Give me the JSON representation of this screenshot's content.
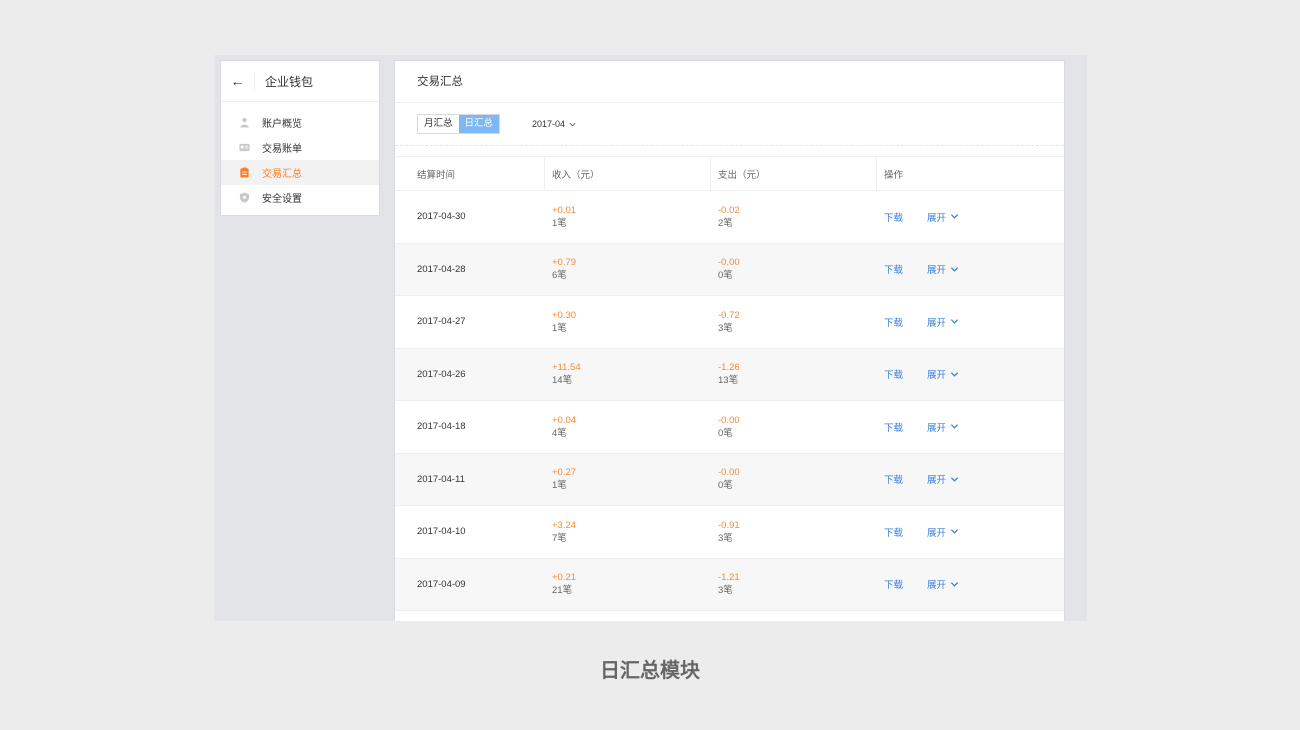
{
  "sidebar": {
    "title": "企业钱包",
    "items": [
      {
        "label": "账户概览",
        "icon": "person-icon",
        "active": false
      },
      {
        "label": "交易账单",
        "icon": "card-icon",
        "active": false
      },
      {
        "label": "交易汇总",
        "icon": "clipboard-icon",
        "active": true
      },
      {
        "label": "安全设置",
        "icon": "shield-icon",
        "active": false
      }
    ]
  },
  "main": {
    "title": "交易汇总",
    "tabs": [
      {
        "label": "月汇总",
        "active": false
      },
      {
        "label": "日汇总",
        "active": true
      }
    ],
    "month": "2017-04",
    "columns": [
      "结算时间",
      "收入（元）",
      "支出（元）",
      "操作"
    ],
    "rows": [
      {
        "date": "2017-04-30",
        "income": "+0.01",
        "income_count": "1笔",
        "expense": "-0.02",
        "expense_count": "2笔"
      },
      {
        "date": "2017-04-28",
        "income": "+0.79",
        "income_count": "6笔",
        "expense": "-0.00",
        "expense_count": "0笔"
      },
      {
        "date": "2017-04-27",
        "income": "+0.30",
        "income_count": "1笔",
        "expense": "-0.72",
        "expense_count": "3笔"
      },
      {
        "date": "2017-04-26",
        "income": "+11.54",
        "income_count": "14笔",
        "expense": "-1.26",
        "expense_count": "13笔"
      },
      {
        "date": "2017-04-18",
        "income": "+0.04",
        "income_count": "4笔",
        "expense": "-0.00",
        "expense_count": "0笔"
      },
      {
        "date": "2017-04-11",
        "income": "+0.27",
        "income_count": "1笔",
        "expense": "-0.00",
        "expense_count": "0笔"
      },
      {
        "date": "2017-04-10",
        "income": "+3.24",
        "income_count": "7笔",
        "expense": "-0.91",
        "expense_count": "3笔"
      },
      {
        "date": "2017-04-09",
        "income": "+0.21",
        "income_count": "21笔",
        "expense": "-1.21",
        "expense_count": "3笔"
      }
    ],
    "actions": {
      "download": "下载",
      "expand": "展开"
    }
  },
  "caption": "日汇总模块",
  "colors": {
    "accent_orange": "#ff7d1d",
    "link_blue": "#3a7fd8",
    "tab_active": "#7bb8f5"
  }
}
